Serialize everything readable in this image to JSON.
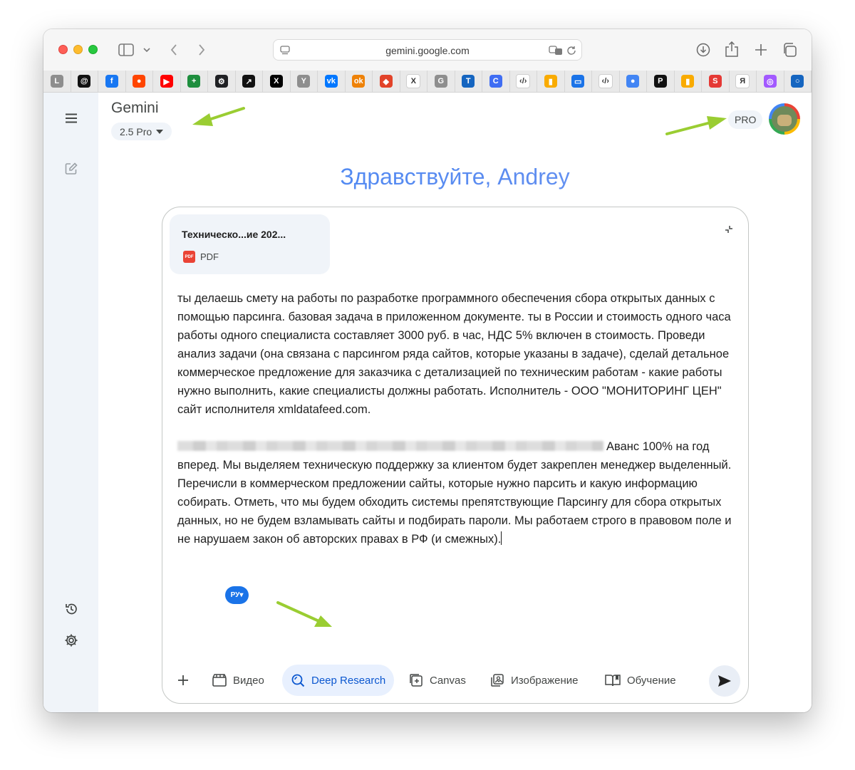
{
  "browser": {
    "url": "gemini.google.com",
    "favorites": [
      {
        "icon": "letter-l-icon",
        "glyph": "L",
        "color": "#8e8e8e"
      },
      {
        "icon": "threads-icon",
        "glyph": "@",
        "color": "#111111"
      },
      {
        "icon": "facebook-icon",
        "glyph": "f",
        "color": "#1877f2"
      },
      {
        "icon": "reddit-icon",
        "glyph": "●",
        "color": "#ff4500"
      },
      {
        "icon": "youtube-icon",
        "glyph": "▶",
        "color": "#ff0000"
      },
      {
        "icon": "sheets-icon",
        "glyph": "+",
        "color": "#1e8e3e"
      },
      {
        "icon": "gear-bookmark-icon",
        "glyph": "⚙",
        "color": "#202124"
      },
      {
        "icon": "black-square-icon",
        "glyph": "↗",
        "color": "#111111"
      },
      {
        "icon": "x-icon",
        "glyph": "X",
        "color": "#000000"
      },
      {
        "icon": "letter-y-icon",
        "glyph": "Y",
        "color": "#8e8e8e"
      },
      {
        "icon": "vk-icon",
        "glyph": "vk",
        "color": "#0077ff"
      },
      {
        "icon": "odnoklassniki-icon",
        "glyph": "ok",
        "color": "#ee8208"
      },
      {
        "icon": "gitlab-icon",
        "glyph": "◆",
        "color": "#e24329"
      },
      {
        "icon": "x-blue-icon",
        "glyph": "X",
        "color": "#ffffff"
      },
      {
        "icon": "letter-g-icon",
        "glyph": "G",
        "color": "#8e8e8e"
      },
      {
        "icon": "letter-t-icon",
        "glyph": "T",
        "color": "#1565c0"
      },
      {
        "icon": "c-icon",
        "glyph": "C",
        "color": "#3f6df3"
      },
      {
        "icon": "code-icon",
        "glyph": "‹/›",
        "color": "#e8e8e8"
      },
      {
        "icon": "analytics-icon",
        "glyph": "▮",
        "color": "#f9ab00"
      },
      {
        "icon": "window-icon",
        "glyph": "▭",
        "color": "#1a73e8"
      },
      {
        "icon": "code-icon-2",
        "glyph": "‹/›",
        "color": "#e8e8e8"
      },
      {
        "icon": "gemini-color-icon",
        "glyph": "●",
        "color": "#4285f4"
      },
      {
        "icon": "p-circle-icon",
        "glyph": "P",
        "color": "#111111"
      },
      {
        "icon": "analytics-icon-2",
        "glyph": "▮",
        "color": "#f9ab00"
      },
      {
        "icon": "s-red-icon",
        "glyph": "S",
        "color": "#e53935"
      },
      {
        "icon": "yandex-icon",
        "glyph": "Я",
        "color": "#e8e8e8"
      },
      {
        "icon": "podcast-icon",
        "glyph": "◎",
        "color": "#a259ff"
      },
      {
        "icon": "circle-blue-icon",
        "glyph": "○",
        "color": "#1565c0"
      }
    ]
  },
  "header": {
    "app_title": "Gemini",
    "model_label": "2.5 Pro",
    "pro_badge": "PRO"
  },
  "greeting": "Здравствуйте, Andrey",
  "composer": {
    "file": {
      "name": "Техническо...ие 202...",
      "type": "PDF",
      "badge": "PDF"
    },
    "paragraph_1": "ты делаешь смету на работы по разработке программного обеспечения сбора открытых данных с помощью парсинга. базовая задача в приложенном документе. ты в России и стоимость одного часа работы одного специалиста составляет 3000 руб. в час, НДС 5% включен в стоимость. Проведи анализ задачи (она связана с парсингом ряда сайтов, которые указаны в задаче), сделай детальное коммерческое предложение для заказчика с детализацией по техническим работам - какие работы нужно выполнить, какие специалисты должны работать. Исполнитель - ООО \"МОНИТОРИНГ ЦЕН\" сайт исполнителя xmldatafeed.com.",
    "paragraph_2": "Аванс 100% на год вперед. Мы выделяем техническую поддержку за клиентом будет закреплен менеджер выделенный. Перечисли в коммерческом предложении сайты, которые нужно парсить и какую информацию собирать. Отметь, что мы будем обходить системы препятствующие Парсингу для сбора открытых данных, но не будем взламывать сайты и подбирать пароли. Мы работаем строго в правовом поле и не нарушаем закон об авторских правах в РФ (и смежных).",
    "lang_pill": "РУ▾"
  },
  "tools": {
    "video": "Видео",
    "deep_research": "Deep Research",
    "canvas": "Canvas",
    "image": "Изображение",
    "learning": "Обучение"
  },
  "colors": {
    "accent": "#0b57d0",
    "arrow": "#9acd32",
    "sidebar_bg": "#f0f4f9"
  }
}
